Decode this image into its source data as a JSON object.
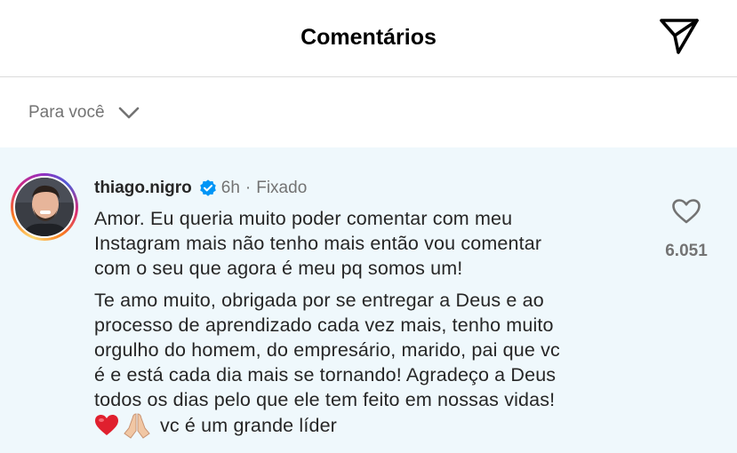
{
  "header": {
    "title": "Comentários",
    "send_icon": "paper-plane-icon"
  },
  "filter": {
    "label": "Para você",
    "icon": "chevron-down-icon"
  },
  "comment": {
    "username": "thiago.nigro",
    "verified": true,
    "time": "6h",
    "separator": "·",
    "pinned": "Fixado",
    "paragraph1": [
      "Amor. Eu queria muito poder comentar com meu",
      "Instagram mais não tenho mais então vou comentar",
      "com o seu que agora é meu pq somos um!"
    ],
    "paragraph2": [
      "Te amo muito, obrigada por se entregar a Deus e ao",
      "processo de aprendizado cada vez mais, tenho muito",
      "orgulho do homem, do empresário, marido, pai que vc",
      "é e está cada dia mais se tornando! Agradeço a Deus",
      "todos os dias pelo que ele tem feito em nossas vidas!"
    ],
    "last_line_emojis": [
      "red-heart-emoji",
      "folded-hands-emoji"
    ],
    "last_line_text": "vc é um grande líder",
    "like_icon": "heart-outline-icon",
    "like_count": "6.051"
  },
  "colors": {
    "comment_background": "#eff8fc",
    "secondary_text": "#737373",
    "verified_blue": "#0095f6",
    "divider": "#dbdbdb"
  }
}
